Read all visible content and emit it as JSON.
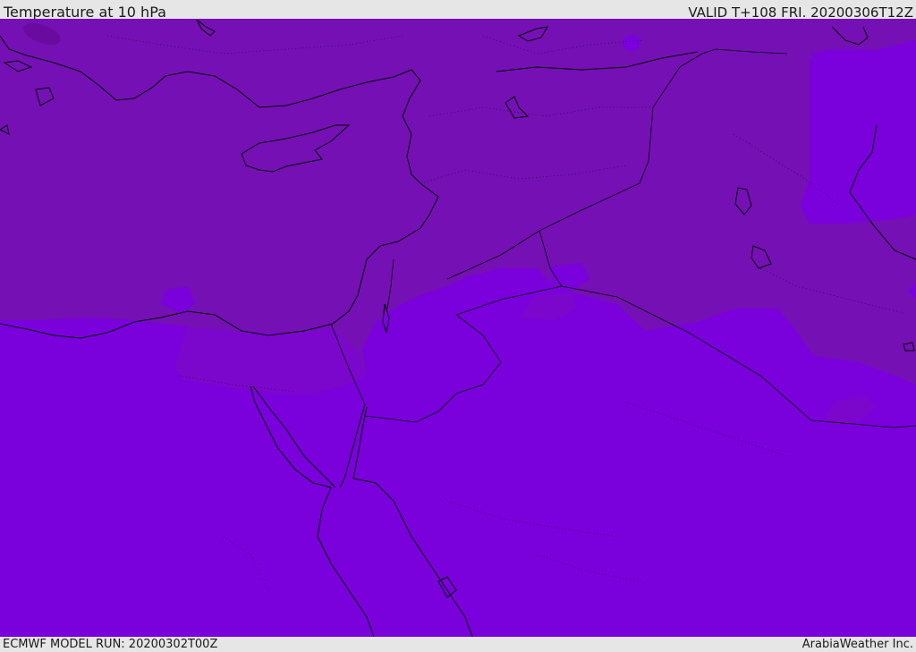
{
  "header": {
    "title": "Temperature at 10 hPa",
    "valid": "VALID T+108 FRI. 20200306T12Z"
  },
  "footer": {
    "model_run": "ECMWF MODEL RUN: 20200302T00Z",
    "credit": "ArabiaWeather Inc."
  },
  "colors": {
    "band_cold": "#7510b5",
    "band_warm": "#7a00dc",
    "band_mid": "#7c07cc",
    "pocket_dark": "#6a0ba0",
    "coastline": "#000000",
    "background": "#e6e6e6"
  }
}
